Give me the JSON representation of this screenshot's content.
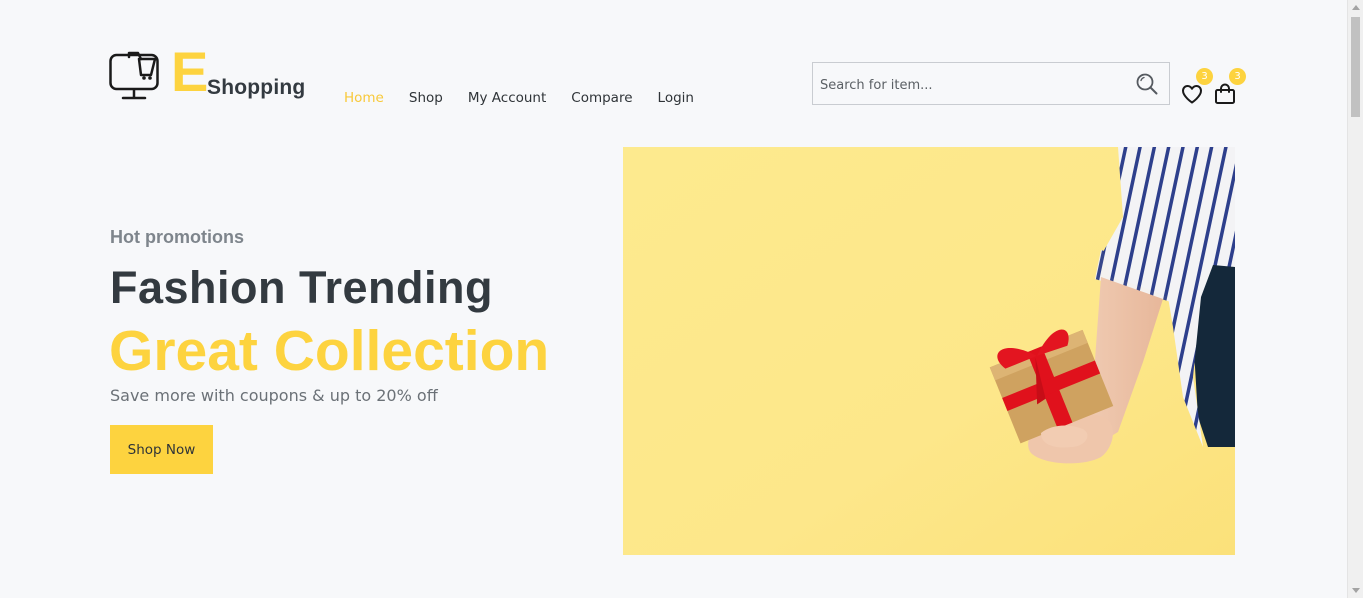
{
  "brand": {
    "logo_big": "E",
    "logo_small": "Shopping"
  },
  "nav": {
    "items": [
      {
        "label": "Home",
        "active": true
      },
      {
        "label": "Shop",
        "active": false
      },
      {
        "label": "My Account",
        "active": false
      },
      {
        "label": "Compare",
        "active": false
      },
      {
        "label": "Login",
        "active": false
      }
    ]
  },
  "search": {
    "placeholder": "Search for item...",
    "value": "",
    "icon": "search-icon"
  },
  "header_icons": {
    "wishlist": {
      "icon": "heart-icon",
      "count": "3"
    },
    "cart": {
      "icon": "shopping-bag-icon",
      "count": "3"
    }
  },
  "hero": {
    "eyebrow": "Hot promotions",
    "headline": "Fashion Trending",
    "subheadline": "Great Collection",
    "tagline": "Save more with coupons & up to 20% off",
    "cta_label": "Shop Now"
  },
  "colors": {
    "accent": "#fdd33f",
    "active_nav": "#f8c93a",
    "text_dark": "#333a40",
    "text_muted": "#7e858c",
    "background": "#f7f8fa"
  }
}
